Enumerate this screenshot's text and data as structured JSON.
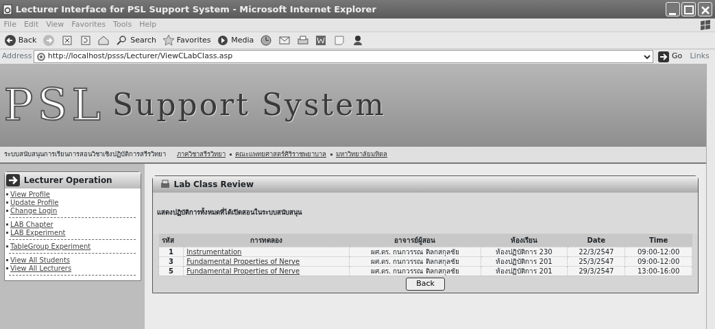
{
  "window": {
    "title": "Lecturer Interface for PSL Support System - Microsoft Internet Explorer"
  },
  "menu": [
    "File",
    "Edit",
    "View",
    "Favorites",
    "Tools",
    "Help"
  ],
  "toolbar": [
    {
      "kind": "back",
      "label": "Back"
    },
    {
      "kind": "forward"
    },
    {
      "kind": "stop"
    },
    {
      "kind": "refresh"
    },
    {
      "kind": "home"
    },
    {
      "kind": "search",
      "label": "Search"
    },
    {
      "kind": "favorites",
      "label": "Favorites"
    },
    {
      "kind": "media",
      "label": "Media"
    },
    {
      "kind": "history"
    },
    {
      "kind": "mail"
    },
    {
      "kind": "print"
    },
    {
      "kind": "edit"
    },
    {
      "kind": "discuss"
    },
    {
      "kind": "messenger"
    }
  ],
  "address": {
    "label": "Address",
    "url": "http://localhost/psss/Lecturer/ViewCLabClass.asp",
    "go": "Go",
    "links": "Links"
  },
  "banner": {
    "logo": "PSL",
    "title": "Support System",
    "tagline": "ระบบสนับสนุนการเรียนการสอนวิชาเชิงปฏิบัติการสรีรวิทยา",
    "links": [
      "ภาควิชาสรีรวิทยา",
      "คณะแพทยศาสตร์ศิริราชพยาบาล",
      "มหาวิทยาลัยมหิดล"
    ]
  },
  "sidebar": {
    "title": "Lecturer Operation",
    "groups": [
      [
        "View Profile",
        "Update Profile",
        "Change Login"
      ],
      [
        "LAB Chapter",
        "LAB Experiment"
      ],
      [
        "TableGroup Experiment"
      ],
      [
        "View All Students",
        "View All Lecturers"
      ]
    ]
  },
  "panel": {
    "title": "Lab Class Review",
    "subtitle": "แสดงปฏิบัติการทั้งหมดที่ได้เปิดสอนในระบบสนับสนุน",
    "columns": [
      "รหัส",
      "การทดลอง",
      "อาจารย์ผู้สอน",
      "ห้องเรียน",
      "Date",
      "Time"
    ],
    "rows": [
      [
        "1",
        "Instrumentation",
        "ผศ.ดร. กนกวรรณ ติลกสกุลชัย",
        "ห้องปฏิบัติการ 230",
        "22/3/2547",
        "09:00-12:00"
      ],
      [
        "3",
        "Fundamental Properties of Nerve",
        "ผศ.ดร. กนกวรรณ ติลกสกุลชัย",
        "ห้องปฏิบัติการ 201",
        "25/3/2547",
        "09:00-12:00"
      ],
      [
        "5",
        "Fundamental Properties of Nerve",
        "ผศ.ดร. กนกวรรณ ติลกสกุลชัย",
        "ห้องปฏิบัติการ 201",
        "29/3/2547",
        "13:00-16:00"
      ]
    ],
    "back": "Back"
  }
}
